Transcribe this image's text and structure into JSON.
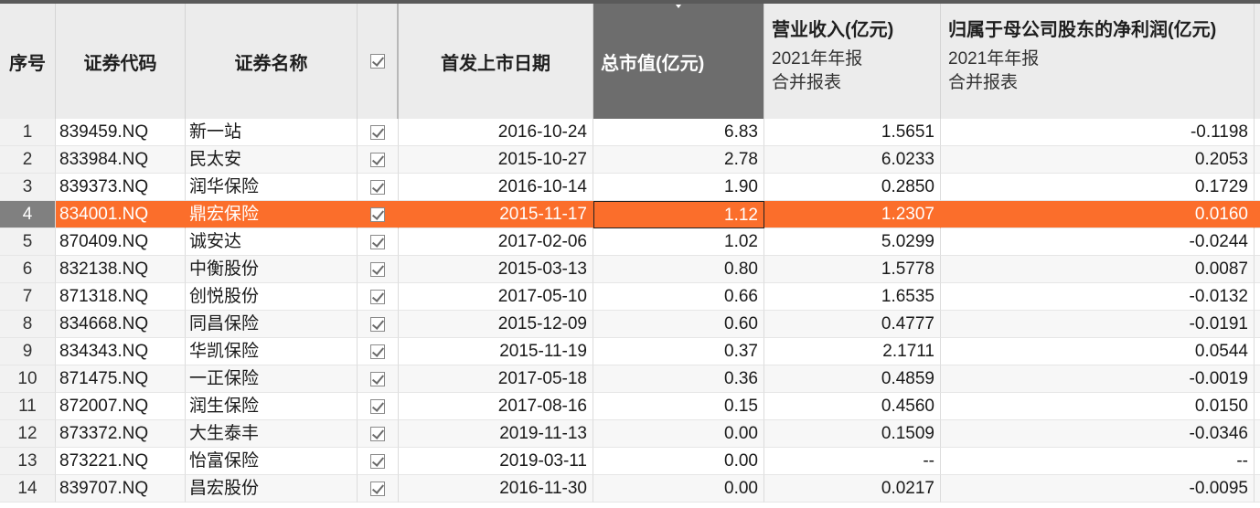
{
  "table": {
    "headers": {
      "index": "序号",
      "code": "证券代码",
      "name": "证券名称",
      "check": "☑",
      "ipo_date": "首发上市日期",
      "mkt_cap": "总市值(亿元)",
      "revenue": {
        "title": "营业收入(亿元)",
        "line1": "2021年年报",
        "line2": "合并报表"
      },
      "net_profit": {
        "title": "归属于母公司股东的净利润(亿元)",
        "line1": "2021年年报",
        "line2": "合并报表"
      }
    },
    "sorted_column": "总市值(亿元)",
    "selected_row": 4,
    "rows": [
      {
        "idx": "1",
        "code": "839459.NQ",
        "name": "新一站",
        "date": "2016-10-24",
        "cap": "6.83",
        "rev": "1.5651",
        "np": "-0.1198"
      },
      {
        "idx": "2",
        "code": "833984.NQ",
        "name": "民太安",
        "date": "2015-10-27",
        "cap": "2.78",
        "rev": "6.0233",
        "np": "0.2053"
      },
      {
        "idx": "3",
        "code": "839373.NQ",
        "name": "润华保险",
        "date": "2016-10-14",
        "cap": "1.90",
        "rev": "0.2850",
        "np": "0.1729"
      },
      {
        "idx": "4",
        "code": "834001.NQ",
        "name": "鼎宏保险",
        "date": "2015-11-17",
        "cap": "1.12",
        "rev": "1.2307",
        "np": "0.0160"
      },
      {
        "idx": "5",
        "code": "870409.NQ",
        "name": "诚安达",
        "date": "2017-02-06",
        "cap": "1.02",
        "rev": "5.0299",
        "np": "-0.0244"
      },
      {
        "idx": "6",
        "code": "832138.NQ",
        "name": "中衡股份",
        "date": "2015-03-13",
        "cap": "0.80",
        "rev": "1.5778",
        "np": "0.0087"
      },
      {
        "idx": "7",
        "code": "871318.NQ",
        "name": "创悦股份",
        "date": "2017-05-10",
        "cap": "0.66",
        "rev": "1.6535",
        "np": "-0.0132"
      },
      {
        "idx": "8",
        "code": "834668.NQ",
        "name": "同昌保险",
        "date": "2015-12-09",
        "cap": "0.60",
        "rev": "0.4777",
        "np": "-0.0191"
      },
      {
        "idx": "9",
        "code": "834343.NQ",
        "name": "华凯保险",
        "date": "2015-11-19",
        "cap": "0.37",
        "rev": "2.1711",
        "np": "0.0544"
      },
      {
        "idx": "10",
        "code": "871475.NQ",
        "name": "一正保险",
        "date": "2017-05-18",
        "cap": "0.36",
        "rev": "0.4859",
        "np": "-0.0019"
      },
      {
        "idx": "11",
        "code": "872007.NQ",
        "name": "润生保险",
        "date": "2017-08-16",
        "cap": "0.15",
        "rev": "0.4560",
        "np": "0.0150"
      },
      {
        "idx": "12",
        "code": "873372.NQ",
        "name": "大生泰丰",
        "date": "2019-11-13",
        "cap": "0.00",
        "rev": "0.1509",
        "np": "-0.0346"
      },
      {
        "idx": "13",
        "code": "873221.NQ",
        "name": "怡富保险",
        "date": "2019-03-11",
        "cap": "0.00",
        "rev": "--",
        "np": "--"
      },
      {
        "idx": "14",
        "code": "839707.NQ",
        "name": "昌宏股份",
        "date": "2016-11-30",
        "cap": "0.00",
        "rev": "0.0217",
        "np": "-0.0095"
      }
    ]
  },
  "colors": {
    "selected_row": "#fb6e2b",
    "sorted_header": "#6d6d6d",
    "header_bg": "#ececec"
  }
}
